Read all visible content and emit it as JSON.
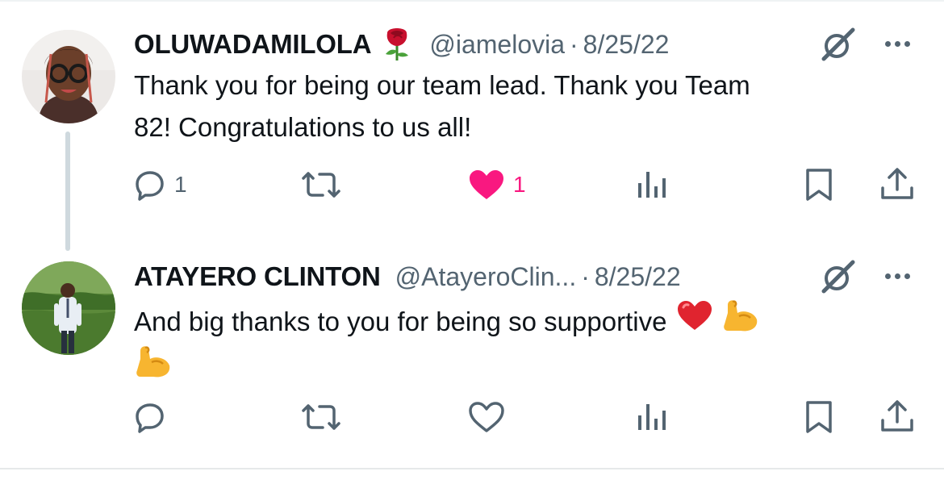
{
  "tweets": [
    {
      "name": "OLUWADAMILOLA",
      "name_emoji": "rose",
      "handle": "@iamelovia",
      "separator": "·",
      "time": "8/25/22",
      "text_line1": "Thank you for being our team lead. Thank you Team",
      "text_line2": "82! Congratulations to us all!",
      "replies": "1",
      "reposts": "",
      "likes": "1",
      "liked": true,
      "views": "",
      "icons": [
        "reply-icon",
        "repost-icon",
        "heart-filled-icon",
        "views-icon",
        "bookmark-icon",
        "share-icon"
      ]
    },
    {
      "name": "ATAYERO CLINTON",
      "handle": "@AtayeroClin...",
      "separator": "·",
      "time": "8/25/22",
      "text_line1": "And big thanks to you for being so supportive",
      "text_emojis": [
        "red-heart",
        "flexed-biceps",
        "flexed-biceps"
      ],
      "replies": "",
      "reposts": "",
      "likes": "",
      "liked": false,
      "views": "",
      "icons": [
        "reply-icon",
        "repost-icon",
        "heart-outline-icon",
        "views-icon",
        "bookmark-icon",
        "share-icon"
      ]
    }
  ],
  "colors": {
    "text": "#0f1419",
    "secondary": "#536471",
    "like_pink": "#f91880",
    "thread_line": "#cfd9de"
  }
}
